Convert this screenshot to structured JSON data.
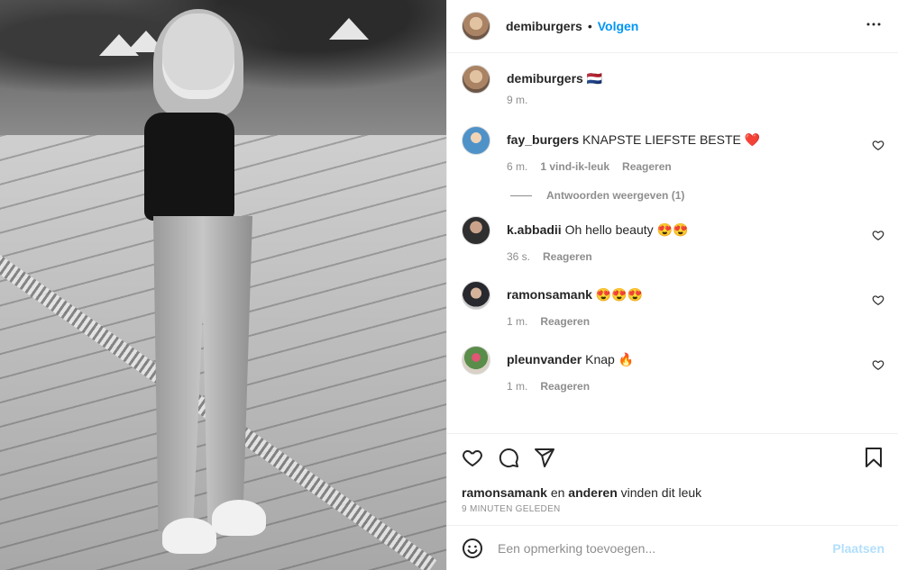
{
  "post": {
    "author": "demiburgers",
    "separator": "•",
    "follow_label": "Volgen",
    "more_icon": "more-horizontal-icon",
    "more_label": "•••"
  },
  "caption": {
    "username": "demiburgers",
    "text": "🇳🇱",
    "time": "9 m."
  },
  "comments": [
    {
      "username": "fay_burgers",
      "text": "KNAPSTE LIEFSTE BESTE ❤️",
      "time": "6 m.",
      "likes": "1 vind-ik-leuk",
      "reply_label": "Reageren",
      "view_replies": "Antwoorden weergeven (1)"
    },
    {
      "username": "k.abbadii",
      "text": "Oh hello beauty 😍😍",
      "time": "36 s.",
      "reply_label": "Reageren"
    },
    {
      "username": "ramonsamank",
      "text": "😍😍😍",
      "time": "1 m.",
      "reply_label": "Reageren"
    },
    {
      "username": "pleunvander",
      "text": "Knap 🔥",
      "time": "1 m.",
      "reply_label": "Reageren"
    }
  ],
  "actions": {
    "like_icon": "heart-icon",
    "comment_icon": "comment-icon",
    "share_icon": "paper-plane-icon",
    "save_icon": "bookmark-icon"
  },
  "likes_line": {
    "user": "ramonsamank",
    "connector": " en ",
    "others": "anderen",
    "suffix": " vinden dit leuk"
  },
  "timestamp": "9 MINUTEN GELEDEN",
  "add_comment": {
    "placeholder": "Een opmerking toevoegen...",
    "post_label": "Plaatsen",
    "emoji_icon": "smiley-icon"
  },
  "colors": {
    "accent": "#0095f6",
    "accent_disabled": "#b2dffc",
    "heart_red": "#ed4956",
    "muted": "#8e8e8e",
    "text": "#262626",
    "border": "#efefef"
  }
}
